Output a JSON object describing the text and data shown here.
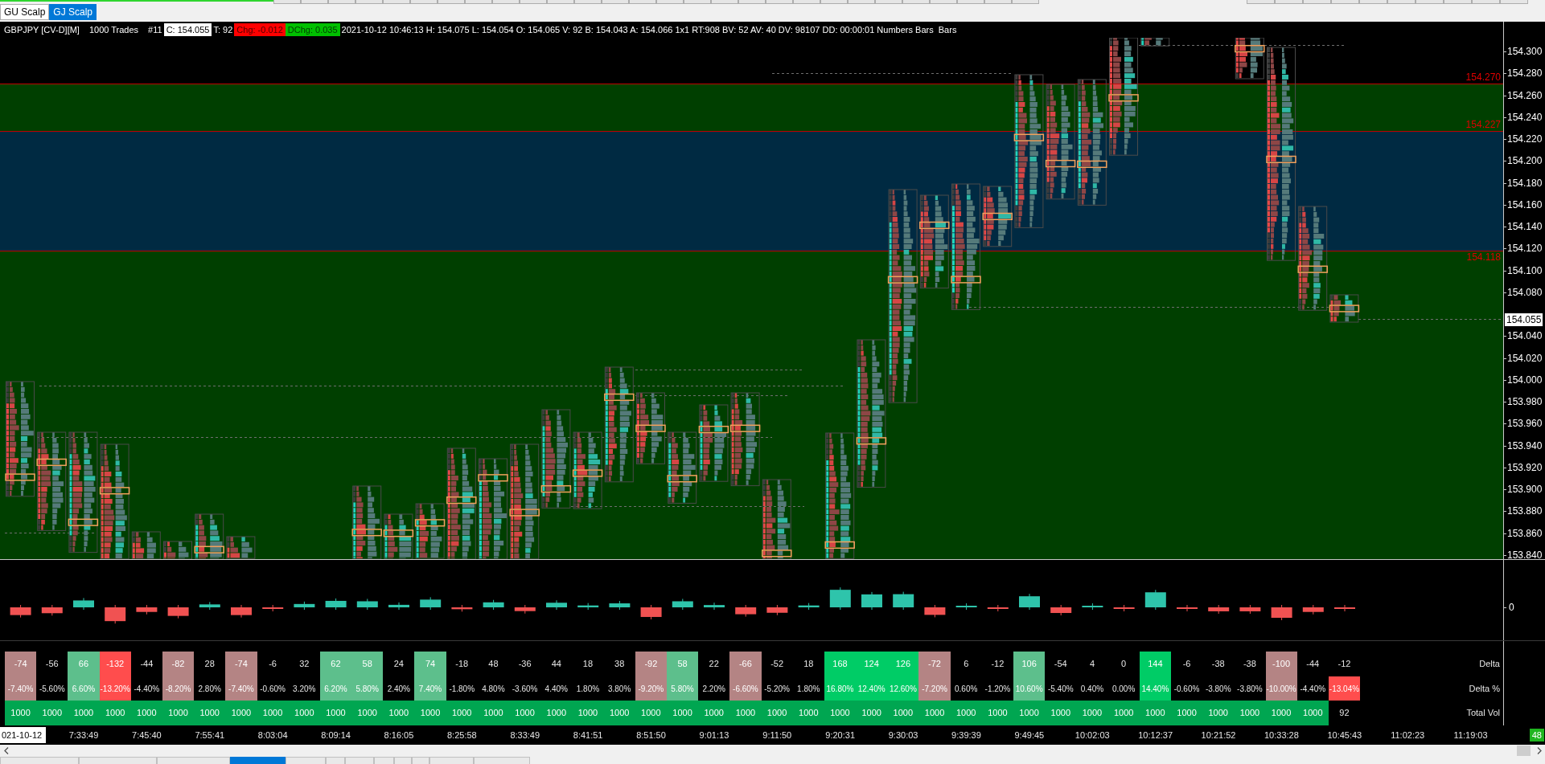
{
  "top_tabs": [
    {
      "label": "GU Scalp",
      "selected": false
    },
    {
      "label": "GJ Scalp",
      "selected": true
    }
  ],
  "info_bar": [
    {
      "kind": "plain",
      "text": "GBPJPY [CV-D][M]"
    },
    {
      "kind": "plain",
      "text": "1000 Trades"
    },
    {
      "kind": "plain",
      "text": "#11"
    },
    {
      "kind": "boxed",
      "text": "C: 154.055"
    },
    {
      "kind": "plain",
      "text": "T: 92"
    },
    {
      "kind": "down",
      "text": "Chg: -0.012"
    },
    {
      "kind": "up",
      "text": "DChg: 0.035"
    },
    {
      "kind": "plain",
      "text": "2021-10-12 10:46:13 H: 154.075 L: 154.054 O: 154.065 V: 92 B: 154.043 A: 154.066 1x1 RT:908 BV: 52 AV: 40 DV: 98107 DD: 00:00:01 Numbers Bars  Bars"
    }
  ],
  "chart": {
    "zones": [
      {
        "color": "#003f00"
      },
      {
        "color": "#002a42"
      },
      {
        "color": "#003f00"
      }
    ],
    "level_lines": [
      "154.270",
      "154.227",
      "154.118"
    ],
    "price_axis": [
      "154.300",
      "154.280",
      "154.260",
      "154.240",
      "154.220",
      "154.200",
      "154.180",
      "154.160",
      "154.140",
      "154.120",
      "154.100",
      "154.080",
      "154.040",
      "154.020",
      "154.000",
      "153.980",
      "153.960",
      "153.940",
      "153.920",
      "153.900",
      "153.880",
      "153.860",
      "153.840"
    ],
    "current_price": "154.055"
  },
  "delta_panel": {
    "axis_label": "0"
  },
  "delta_table": {
    "rows": [
      {
        "label": "Delta",
        "cells": [
          {
            "text": "-74",
            "color": "#b48484"
          },
          {
            "text": "-56"
          },
          {
            "text": "66",
            "color": "#5dbf8c"
          },
          {
            "text": "-132",
            "color": "#ff4d4d"
          },
          {
            "text": "-44"
          },
          {
            "text": "-82",
            "color": "#b48484"
          },
          {
            "text": "28"
          },
          {
            "text": "-74",
            "color": "#b48484"
          },
          {
            "text": "-6"
          },
          {
            "text": "32"
          },
          {
            "text": "62",
            "color": "#5dbf8c"
          },
          {
            "text": "58",
            "color": "#5dbf8c"
          },
          {
            "text": "24"
          },
          {
            "text": "74",
            "color": "#5dbf8c"
          },
          {
            "text": "-18"
          },
          {
            "text": "48"
          },
          {
            "text": "-36"
          },
          {
            "text": "44"
          },
          {
            "text": "18"
          },
          {
            "text": "38"
          },
          {
            "text": "-92",
            "color": "#b48484"
          },
          {
            "text": "58",
            "color": "#5dbf8c"
          },
          {
            "text": "22"
          },
          {
            "text": "-66",
            "color": "#b48484"
          },
          {
            "text": "-52"
          },
          {
            "text": "18"
          },
          {
            "text": "168",
            "color": "#00cc66"
          },
          {
            "text": "124",
            "color": "#00cc66"
          },
          {
            "text": "126",
            "color": "#00cc66"
          },
          {
            "text": "-72",
            "color": "#b48484"
          },
          {
            "text": "6"
          },
          {
            "text": "-12"
          },
          {
            "text": "106",
            "color": "#5dbf8c"
          },
          {
            "text": "-54"
          },
          {
            "text": "4"
          },
          {
            "text": "0"
          },
          {
            "text": "144",
            "color": "#00cc66"
          },
          {
            "text": "-6"
          },
          {
            "text": "-38"
          },
          {
            "text": "-38"
          },
          {
            "text": "-100",
            "color": "#b48484"
          },
          {
            "text": "-44"
          },
          {
            "text": "-12"
          }
        ]
      },
      {
        "label": "Delta %",
        "cells": [
          {
            "text": "-7.40%",
            "color": "#b48484"
          },
          {
            "text": "-5.60%"
          },
          {
            "text": "6.60%",
            "color": "#5dbf8c"
          },
          {
            "text": "-13.20%",
            "color": "#ff4d4d"
          },
          {
            "text": "-4.40%"
          },
          {
            "text": "-8.20%",
            "color": "#b48484"
          },
          {
            "text": "2.80%"
          },
          {
            "text": "-7.40%",
            "color": "#b48484"
          },
          {
            "text": "-0.60%"
          },
          {
            "text": "3.20%"
          },
          {
            "text": "6.20%",
            "color": "#5dbf8c"
          },
          {
            "text": "5.80%",
            "color": "#5dbf8c"
          },
          {
            "text": "2.40%"
          },
          {
            "text": "7.40%",
            "color": "#5dbf8c"
          },
          {
            "text": "-1.80%"
          },
          {
            "text": "4.80%"
          },
          {
            "text": "-3.60%"
          },
          {
            "text": "4.40%"
          },
          {
            "text": "1.80%"
          },
          {
            "text": "3.80%"
          },
          {
            "text": "-9.20%",
            "color": "#b48484"
          },
          {
            "text": "5.80%",
            "color": "#5dbf8c"
          },
          {
            "text": "2.20%"
          },
          {
            "text": "-6.60%",
            "color": "#b48484"
          },
          {
            "text": "-5.20%"
          },
          {
            "text": "1.80%"
          },
          {
            "text": "16.80%",
            "color": "#00cc66"
          },
          {
            "text": "12.40%",
            "color": "#00cc66"
          },
          {
            "text": "12.60%",
            "color": "#00cc66"
          },
          {
            "text": "-7.20%",
            "color": "#b48484"
          },
          {
            "text": "0.60%"
          },
          {
            "text": "-1.20%"
          },
          {
            "text": "10.60%",
            "color": "#5dbf8c"
          },
          {
            "text": "-5.40%"
          },
          {
            "text": "0.40%"
          },
          {
            "text": "0.00%"
          },
          {
            "text": "14.40%",
            "color": "#00cc66"
          },
          {
            "text": "-0.60%"
          },
          {
            "text": "-3.80%"
          },
          {
            "text": "-3.80%"
          },
          {
            "text": "-10.00%",
            "color": "#b48484"
          },
          {
            "text": "-4.40%"
          },
          {
            "text": "-13.04%",
            "color": "#ff4d4d"
          }
        ]
      },
      {
        "label": "Total Vol",
        "cells": [
          {
            "text": "1000",
            "color": "#00a651"
          },
          {
            "text": "1000",
            "color": "#00a651"
          },
          {
            "text": "1000",
            "color": "#00a651"
          },
          {
            "text": "1000",
            "color": "#00a651"
          },
          {
            "text": "1000",
            "color": "#00a651"
          },
          {
            "text": "1000",
            "color": "#00a651"
          },
          {
            "text": "1000",
            "color": "#00a651"
          },
          {
            "text": "1000",
            "color": "#00a651"
          },
          {
            "text": "1000",
            "color": "#00a651"
          },
          {
            "text": "1000",
            "color": "#00a651"
          },
          {
            "text": "1000",
            "color": "#00a651"
          },
          {
            "text": "1000",
            "color": "#00a651"
          },
          {
            "text": "1000",
            "color": "#00a651"
          },
          {
            "text": "1000",
            "color": "#00a651"
          },
          {
            "text": "1000",
            "color": "#00a651"
          },
          {
            "text": "1000",
            "color": "#00a651"
          },
          {
            "text": "1000",
            "color": "#00a651"
          },
          {
            "text": "1000",
            "color": "#00a651"
          },
          {
            "text": "1000",
            "color": "#00a651"
          },
          {
            "text": "1000",
            "color": "#00a651"
          },
          {
            "text": "1000",
            "color": "#00a651"
          },
          {
            "text": "1000",
            "color": "#00a651"
          },
          {
            "text": "1000",
            "color": "#00a651"
          },
          {
            "text": "1000",
            "color": "#00a651"
          },
          {
            "text": "1000",
            "color": "#00a651"
          },
          {
            "text": "1000",
            "color": "#00a651"
          },
          {
            "text": "1000",
            "color": "#00a651"
          },
          {
            "text": "1000",
            "color": "#00a651"
          },
          {
            "text": "1000",
            "color": "#00a651"
          },
          {
            "text": "1000",
            "color": "#00a651"
          },
          {
            "text": "1000",
            "color": "#00a651"
          },
          {
            "text": "1000",
            "color": "#00a651"
          },
          {
            "text": "1000",
            "color": "#00a651"
          },
          {
            "text": "1000",
            "color": "#00a651"
          },
          {
            "text": "1000",
            "color": "#00a651"
          },
          {
            "text": "1000",
            "color": "#00a651"
          },
          {
            "text": "1000",
            "color": "#00a651"
          },
          {
            "text": "1000",
            "color": "#00a651"
          },
          {
            "text": "1000",
            "color": "#00a651"
          },
          {
            "text": "1000",
            "color": "#00a651"
          },
          {
            "text": "1000",
            "color": "#00a651"
          },
          {
            "text": "1000",
            "color": "#00a651"
          },
          {
            "text": "92"
          }
        ]
      }
    ]
  },
  "time_axis": {
    "date": "021-10-12",
    "labels": [
      "7:33:49",
      "7:45:40",
      "7:55:41",
      "8:03:04",
      "8:09:14",
      "8:16:05",
      "8:25:58",
      "8:33:49",
      "8:41:51",
      "8:51:50",
      "9:01:13",
      "9:11:50",
      "9:20:31",
      "9:30:03",
      "9:39:39",
      "9:49:45",
      "10:02:03",
      "10:12:37",
      "10:21:52",
      "10:33:28",
      "10:45:43",
      "11:02:23",
      "11:19:03"
    ],
    "badge": "48"
  },
  "bottom_tabs": [
    {
      "selected": false
    },
    {
      "selected": false
    },
    {
      "selected": false
    },
    {
      "selected": true
    },
    {
      "selected": false
    },
    {
      "selected": false
    },
    {
      "selected": false
    },
    {
      "selected": false
    },
    {
      "selected": false
    },
    {
      "selected": false
    },
    {
      "selected": false
    },
    {
      "selected": false
    }
  ]
}
